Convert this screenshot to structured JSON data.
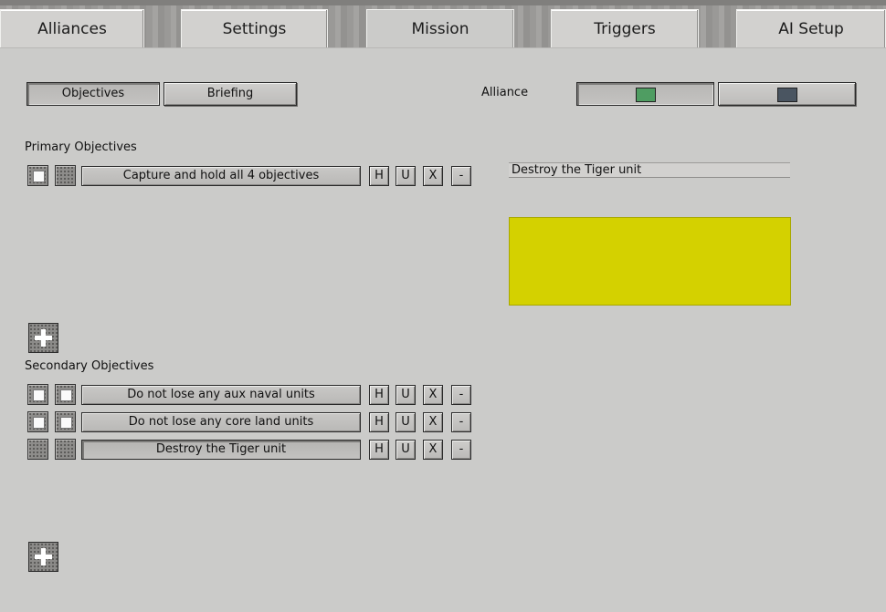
{
  "tabs": [
    {
      "label": "Alliances"
    },
    {
      "label": "Settings"
    },
    {
      "label": "Mission"
    },
    {
      "label": "Triggers"
    },
    {
      "label": "AI Setup"
    }
  ],
  "active_tab": "Mission",
  "subtabs": {
    "objectives": "Objectives",
    "briefing": "Briefing",
    "selected": "Objectives"
  },
  "alliance": {
    "label": "Alliance",
    "options": [
      {
        "color": "#4f9d62",
        "selected": true
      },
      {
        "color": "#4a5561",
        "selected": false
      }
    ]
  },
  "primary": {
    "heading": "Primary Objectives",
    "items": [
      {
        "text": "Capture and hold all 4 objectives",
        "check1": true,
        "check2": false,
        "pressed": false
      }
    ]
  },
  "secondary": {
    "heading": "Secondary Objectives",
    "items": [
      {
        "text": "Do not lose any aux naval units",
        "check1": true,
        "check2": true,
        "pressed": false
      },
      {
        "text": "Do not lose any core land units",
        "check1": true,
        "check2": true,
        "pressed": false
      },
      {
        "text": "Destroy the Tiger unit",
        "check1": false,
        "check2": false,
        "pressed": true
      }
    ]
  },
  "row_buttons": {
    "h": "H",
    "u": "U",
    "x": "X",
    "minus": "-"
  },
  "detail": {
    "name_value": "Destroy the Tiger unit",
    "color": "#d4d100"
  },
  "icons": {
    "add": "plus-icon"
  }
}
